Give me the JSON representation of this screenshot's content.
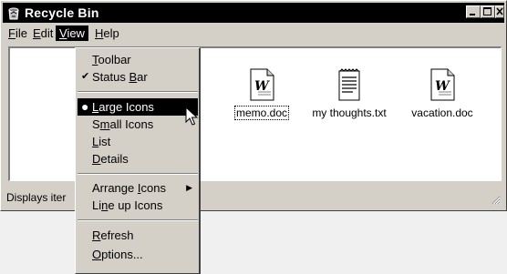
{
  "window": {
    "title": "Recycle Bin"
  },
  "menubar": [
    "File",
    "Edit",
    "View",
    "Help"
  ],
  "view_menu": {
    "toolbar": "Toolbar",
    "status_bar": "Status Bar",
    "large_icons": "Large Icons",
    "small_icons": "Small Icons",
    "list": "List",
    "details": "Details",
    "arrange_icons": "Arrange Icons",
    "line_up_icons": "Line up Icons",
    "refresh": "Refresh",
    "options": "Options..."
  },
  "files": [
    {
      "name": "memo.doc",
      "icon": "word-document-icon"
    },
    {
      "name": "my thoughts.txt",
      "icon": "text-document-icon"
    },
    {
      "name": "vacation.doc",
      "icon": "word-document-icon"
    }
  ],
  "statusbar": {
    "text": "Displays iter"
  }
}
